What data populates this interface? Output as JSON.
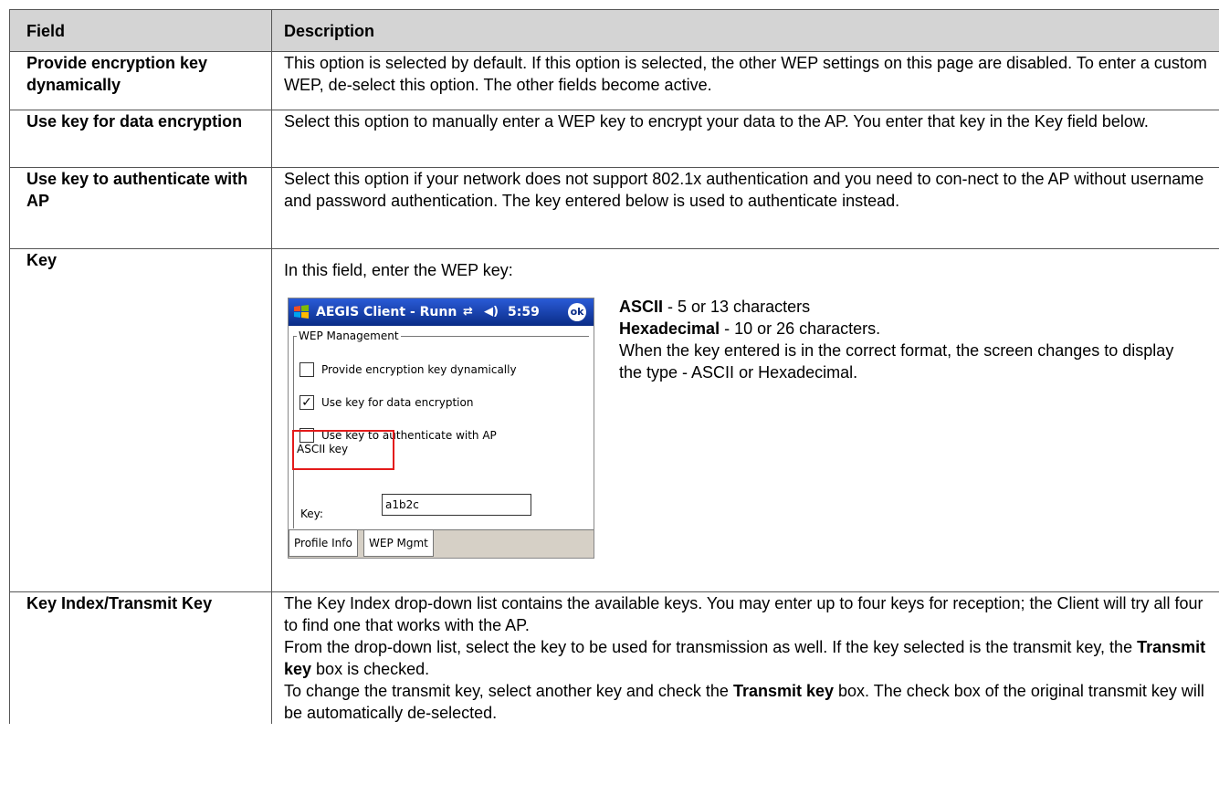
{
  "header": {
    "col1": "Field",
    "col2": "Description"
  },
  "rows": [
    {
      "field": "Provide encryption key dynamically",
      "desc": "This option is selected by default. If this option is selected, the other WEP settings on this page are disabled. To enter a custom WEP, de-select this option. The other fields become active."
    },
    {
      "field": "Use key for data encryption",
      "desc": "Select this option to manually enter a WEP key to encrypt your data to the AP. You enter that key in the Key field below."
    },
    {
      "field": "Use key to authenticate with AP",
      "desc": "Select this option if your network does not support 802.1x authentication and you need to con-nect to the AP without username and password authentication. The key entered below is used to authenticate instead."
    }
  ],
  "key_row": {
    "field": "Key",
    "intro": "In this field, enter the WEP key:",
    "ascii_label": "ASCII",
    "ascii_text": " - 5 or 13 characters",
    "hex_label": "Hexadecimal",
    "hex_text": " - 10 or 26 characters.",
    "note": "When the key entered is in the correct format, the screen changes to display the type - ASCII or Hexadecimal."
  },
  "pda": {
    "title": "AEGIS Client - Runn",
    "time": "5:59",
    "ok_label": "ok",
    "group_label": "WEP Management",
    "options": [
      {
        "label": "Provide encryption key dynamically",
        "checked": false
      },
      {
        "label": "Use key for data encryption",
        "checked": true
      },
      {
        "label": "Use key to authenticate with AP",
        "checked": false
      }
    ],
    "key_type": "ASCII key",
    "key_label": "Key:",
    "key_value": "a1b2c",
    "tabs": [
      "Profile Info",
      "WEP Mgmt"
    ],
    "checkmark": "✓",
    "icons": {
      "start": "windows-flag-icon",
      "conn": "connectivity-icon",
      "volume": "speaker-icon"
    }
  },
  "last_row": {
    "field": "Key Index/Transmit Key",
    "p1": "The Key Index drop-down list contains the available keys. You may enter up to four keys for reception; the Client will try all four to find one that works with the AP.",
    "p2a": "From the drop-down list, select the key to be used for transmission as well. If the key selected is the transmit key, the ",
    "p2b": "Transmit key",
    "p2c": " box is checked.",
    "p3a": "To change the transmit key, select another key and check the ",
    "p3b": "Transmit key",
    "p3c": " box. The check box of the original transmit key will be automatically de-selected."
  }
}
